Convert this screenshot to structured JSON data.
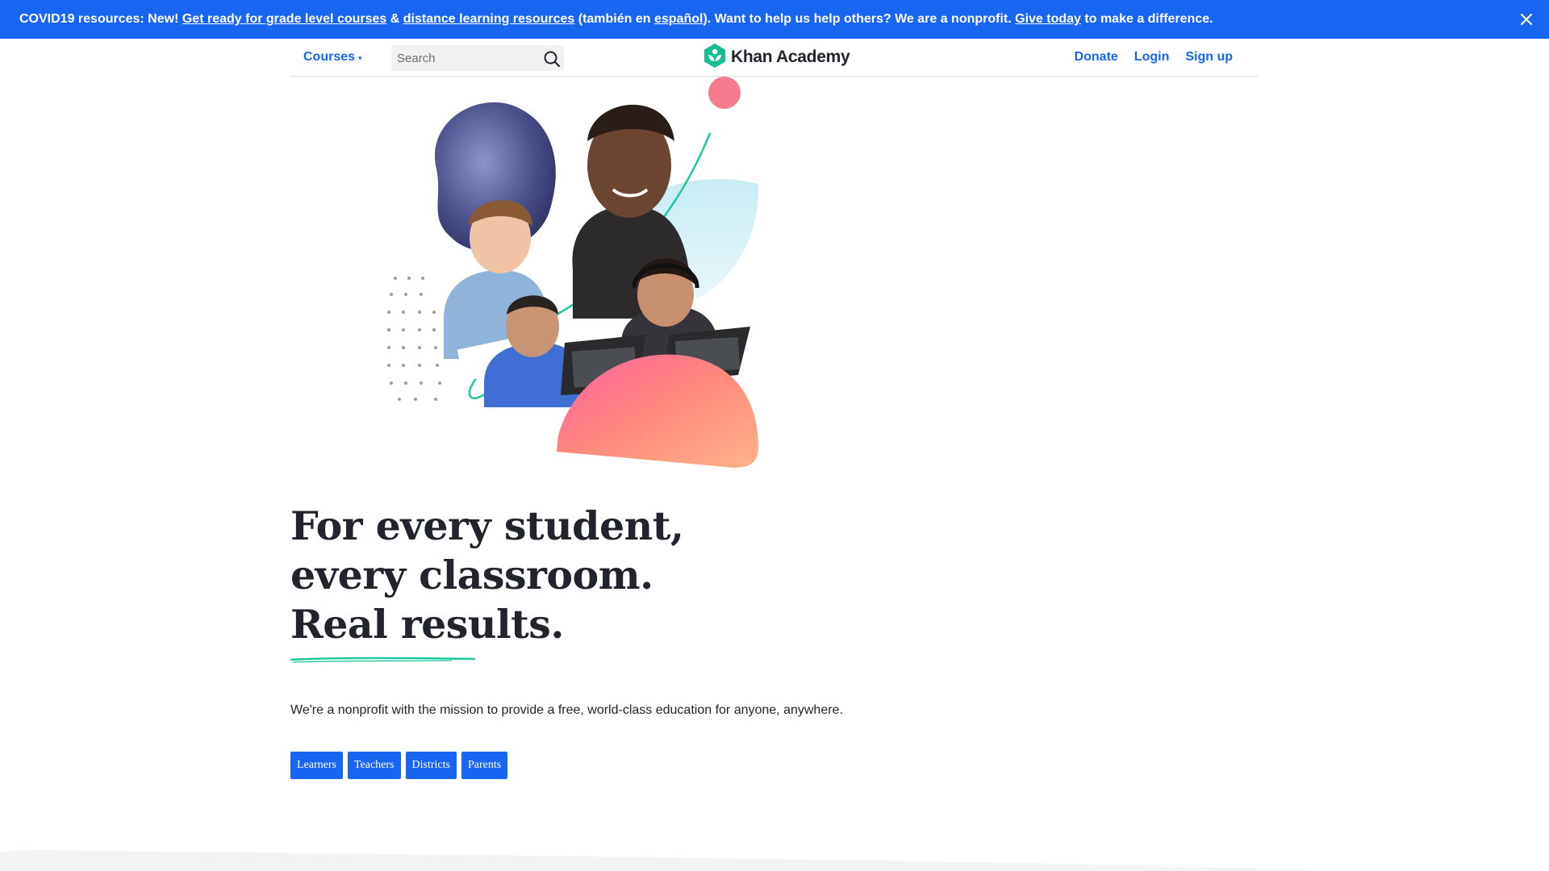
{
  "banner": {
    "prefix": "COVID19 resources: New! ",
    "link_grade": "Get ready for grade level courses",
    "amp": " & ",
    "link_distance": "distance learning resources",
    "paren_open": " (también en ",
    "link_espanol": "español",
    "after_espanol": "). Want to help us help others? We are a nonprofit. ",
    "link_give": "Give today",
    "suffix": " to make a difference.",
    "close_icon": "close-icon"
  },
  "nav": {
    "courses_label": "Courses",
    "courses_caret": "▾",
    "search_placeholder": "Search",
    "logo_text": "Khan Academy",
    "donate": "Donate",
    "login": "Login",
    "signup": "Sign up"
  },
  "hero": {
    "headline": [
      "For every student,",
      "every classroom.",
      "Real results."
    ],
    "mission": "We're a nonprofit with the mission to provide a free, world-class education for anyone, anywhere.",
    "ctas": [
      "Learners",
      "Teachers",
      "Districts",
      "Parents"
    ]
  },
  "colors": {
    "brand_blue": "#1865f2",
    "logo_green": "#14bf96",
    "text_dark": "#21242c"
  }
}
